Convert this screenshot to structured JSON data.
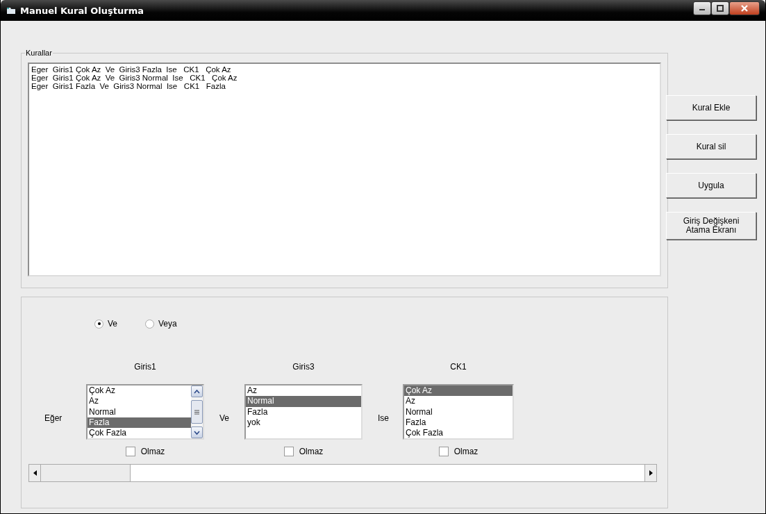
{
  "window": {
    "title": "Manuel Kural Oluşturma"
  },
  "rules": {
    "label": "Kurallar",
    "lines": [
      "Eger  Giris1 Çok Az  Ve  Giris3 Fazla  Ise   CK1   Çok Az",
      "Eger  Giris1 Çok Az  Ve  Giris3 Normal  Ise   CK1   Çok Az",
      "Eger  Giris1 Fazla  Ve  Giris3 Normal  Ise   CK1   Fazla"
    ]
  },
  "buttons": [
    {
      "label": "Kural Ekle"
    },
    {
      "label": "Kural sil"
    },
    {
      "label": "Uygula"
    },
    {
      "label": "Giriş Değişkeni\nAtama Ekranı"
    }
  ],
  "logic": [
    {
      "label": "Ve",
      "selected": true
    },
    {
      "label": "Veya",
      "selected": false
    }
  ],
  "columns": [
    {
      "prefix": "Eğer",
      "header": "Giris1",
      "scrollable": true,
      "items": [
        {
          "label": "Çok Az",
          "selected": false
        },
        {
          "label": "Az",
          "selected": false
        },
        {
          "label": "Normal",
          "selected": false
        },
        {
          "label": "Fazla",
          "selected": true
        },
        {
          "label": "Çok Fazla",
          "selected": false
        }
      ],
      "checkbox": {
        "label": "Olmaz",
        "checked": false
      }
    },
    {
      "prefix": "Ve",
      "header": "Giris3",
      "scrollable": false,
      "items": [
        {
          "label": "Az",
          "selected": false
        },
        {
          "label": "Normal",
          "selected": true
        },
        {
          "label": "Fazla",
          "selected": false
        },
        {
          "label": "yok",
          "selected": false
        }
      ],
      "checkbox": {
        "label": "Olmaz",
        "checked": false
      }
    },
    {
      "prefix": "Ise",
      "header": "CK1",
      "scrollable": false,
      "items": [
        {
          "label": "Çok Az",
          "selected": true
        },
        {
          "label": "Az",
          "selected": false
        },
        {
          "label": "Normal",
          "selected": false
        },
        {
          "label": "Fazla",
          "selected": false
        },
        {
          "label": "Çok Fazla",
          "selected": false
        }
      ],
      "checkbox": {
        "label": "Olmaz",
        "checked": false
      }
    }
  ]
}
